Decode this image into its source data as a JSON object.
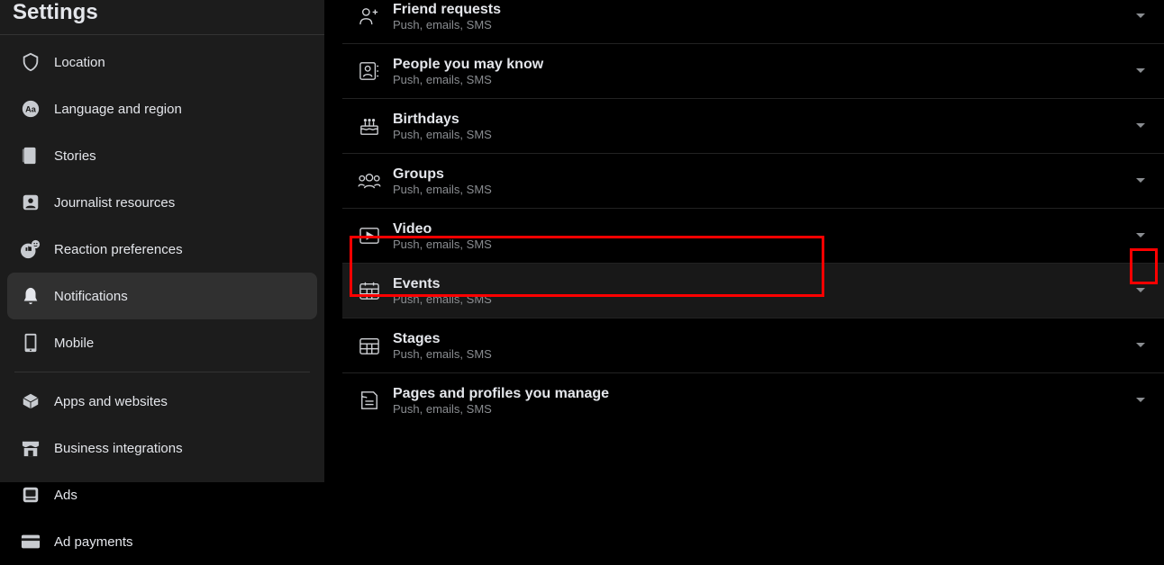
{
  "sidebar": {
    "title": "Settings",
    "items": [
      {
        "label": "Location"
      },
      {
        "label": "Language and region"
      },
      {
        "label": "Stories"
      },
      {
        "label": "Journalist resources"
      },
      {
        "label": "Reaction preferences"
      },
      {
        "label": "Notifications"
      },
      {
        "label": "Mobile"
      },
      {
        "label": "Apps and websites"
      },
      {
        "label": "Business integrations"
      },
      {
        "label": "Ads"
      },
      {
        "label": "Ad payments"
      }
    ]
  },
  "main": {
    "sub": "Push, emails, SMS",
    "rows": [
      {
        "title": "Friend requests"
      },
      {
        "title": "People you may know"
      },
      {
        "title": "Birthdays"
      },
      {
        "title": "Groups"
      },
      {
        "title": "Video"
      },
      {
        "title": "Events"
      },
      {
        "title": "Stages"
      },
      {
        "title": "Pages and profiles you manage"
      }
    ]
  }
}
